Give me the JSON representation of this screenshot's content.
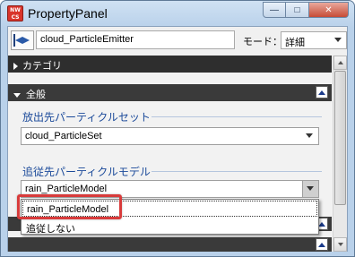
{
  "window": {
    "title": "PropertyPanel",
    "app_icon_text": "NW CS",
    "controls": {
      "minimize": "—",
      "maximize": "□",
      "close": "✕"
    }
  },
  "toolbar": {
    "node_name": "cloud_ParticleEmitter",
    "mode_label": "モード：",
    "mode_value": "詳細"
  },
  "panel": {
    "category_header": "カテゴリ",
    "general_header": "全般",
    "emit_set_label": "放出先パーティクルセット",
    "emit_set_value": "cloud_ParticleSet",
    "follow_model_label": "追従先パーティクルモデル",
    "follow_model_value": "rain_ParticleModel",
    "dropdown_options": [
      "rain_ParticleModel",
      "追従しない"
    ],
    "dropdown_selected_index": 0
  },
  "colors": {
    "section_label": "#1b4a9a",
    "header_bg": "#2e2e2e",
    "highlight": "#d83b3b"
  }
}
